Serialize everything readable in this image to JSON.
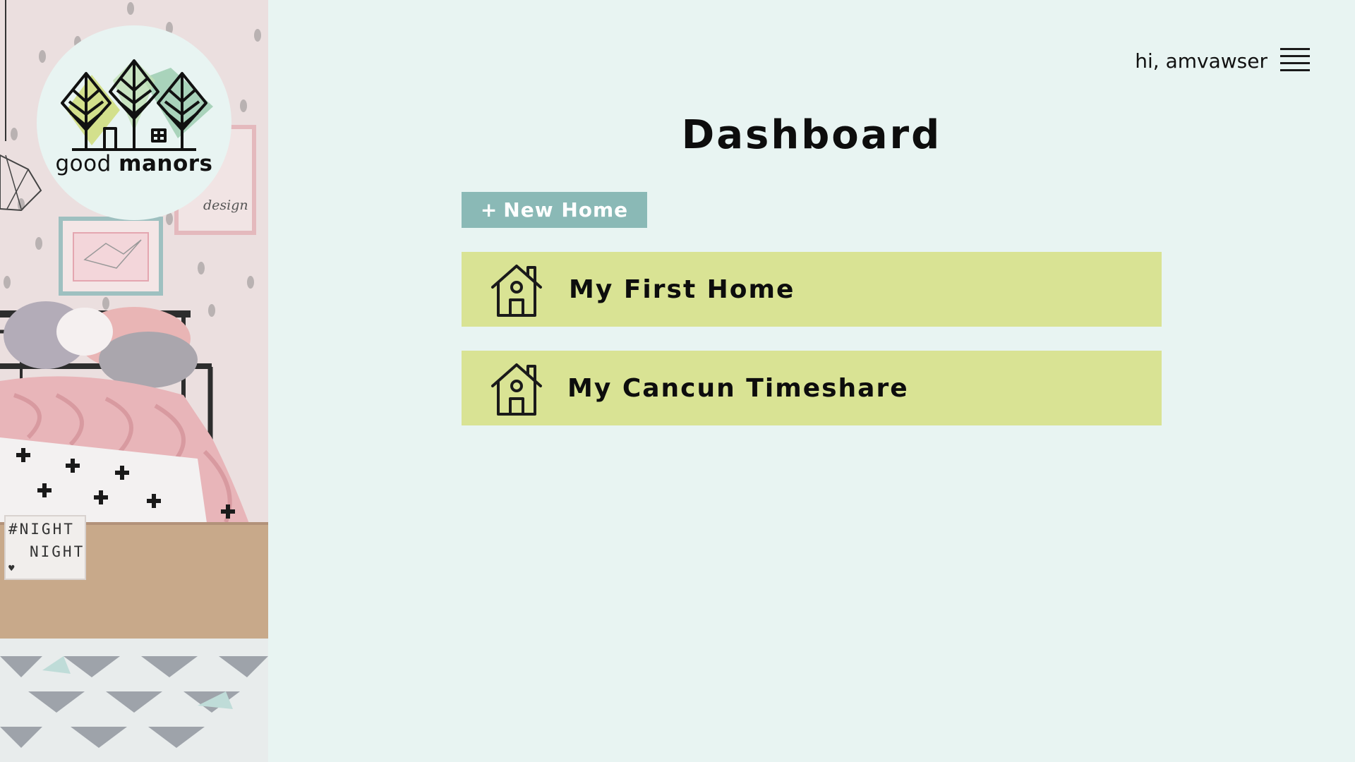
{
  "brand": {
    "name_light": "good ",
    "name_bold": "manors",
    "logo_icon": "three-trees-house-icon"
  },
  "decor": {
    "lightbox_line1": "#NIGHT",
    "lightbox_line2": "NIGHT",
    "lightbox_heart": "♥",
    "poster_text": "design"
  },
  "header": {
    "greeting": "hi, amvawser",
    "menu_icon": "hamburger-menu-icon"
  },
  "page": {
    "title": "Dashboard"
  },
  "actions": {
    "new_home_plus": "+",
    "new_home_label": "New Home"
  },
  "homes": [
    {
      "name": "My First Home",
      "icon": "house-icon"
    },
    {
      "name": "My Cancun Timeshare",
      "icon": "house-icon"
    }
  ],
  "colors": {
    "background": "#e8f4f2",
    "card": "#d9e394",
    "button": "#8ab9b6",
    "text": "#0d0d0d"
  }
}
